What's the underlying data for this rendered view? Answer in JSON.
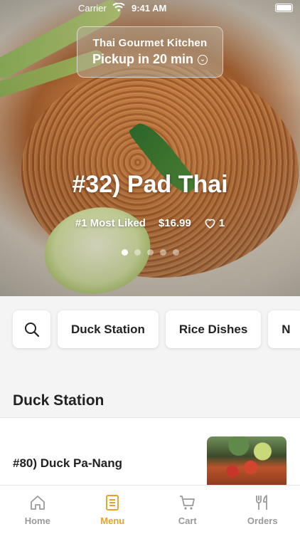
{
  "status_bar": {
    "carrier": "Carrier",
    "time": "9:41 AM"
  },
  "restaurant": {
    "name": "Thai Gourmet Kitchen",
    "pickup": "Pickup in 20 min"
  },
  "featured": {
    "title": "#32) Pad Thai",
    "badge": "#1 Most Liked",
    "price": "$16.99",
    "likes": "1",
    "carousel_pages": 5,
    "active_page": 1
  },
  "categories": [
    "Duck Station",
    "Rice Dishes",
    "N"
  ],
  "section": {
    "title": "Duck Station"
  },
  "items": [
    {
      "name": "#80) Duck Pa-Nang"
    }
  ],
  "tabs": [
    {
      "label": "Home",
      "icon": "home-icon"
    },
    {
      "label": "Menu",
      "icon": "menu-icon"
    },
    {
      "label": "Cart",
      "icon": "cart-icon"
    },
    {
      "label": "Orders",
      "icon": "fork-knife-icon"
    }
  ],
  "colors": {
    "accent": "#e3a32b",
    "inactive": "#9a9a9a",
    "background": "#f4f4f4"
  }
}
